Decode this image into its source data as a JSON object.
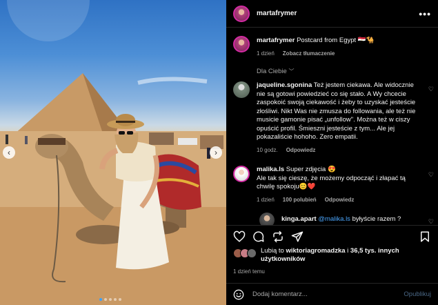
{
  "post": {
    "author": "martafrymer",
    "caption_user": "martafrymer",
    "caption_text": "Postcard from Egypt 🇪🇬🐪",
    "caption_age": "1 dzień",
    "translate_label": "Zobacz tłumaczenie"
  },
  "sort_label": "Dla Ciebie",
  "comments": [
    {
      "user": "jaqueline.sgonina",
      "text": "Też jestem ciekawa. Ale widocznie nie są gotowi powiedzieć co się stało. A Wy chcecie zaspokoić swoją ciekawość i żeby to uzyskać jesteście złośliwi. Nikt Was nie zmusza do followania, ale też nie musicie gamonie pisać „unfollow\". Można też w ciszy opuścić profil. Śmieszni jesteście z tym... Ale jej pokazaliście hohoho. Zero empatii.",
      "age": "10 godz.",
      "reply": "Odpowiedz"
    },
    {
      "user": "malika.ls",
      "text": "Super zdjęcia 😍",
      "text2": "Ale tak się cieszę, że możemy odpocząć i złapać tą chwilę spokoju😊❤️",
      "age": "1 dzień",
      "likes": "100 polubień",
      "reply": "Odpowiedz"
    },
    {
      "user": "kinga.apart",
      "mention": "@malika.ls",
      "text": "byłyście razem ?"
    }
  ],
  "likes_text_prefix": "Lubią to ",
  "likes_user": "wiktoriagromadzka",
  "likes_text_mid": " i ",
  "likes_count": "36,5 tys. innych użytkowników",
  "post_date": "1 dzień temu",
  "composer": {
    "placeholder": "Dodaj komentarz...",
    "submit": "Opublikuj"
  },
  "colors": {
    "accent_link": "#4aa3f8",
    "muted": "#a8a8a8",
    "story_ring": "#d32aa3"
  },
  "icons": [
    "heart-icon",
    "comment-icon",
    "share-icon",
    "send-icon",
    "bookmark-icon",
    "emoji-icon",
    "more-icon"
  ]
}
